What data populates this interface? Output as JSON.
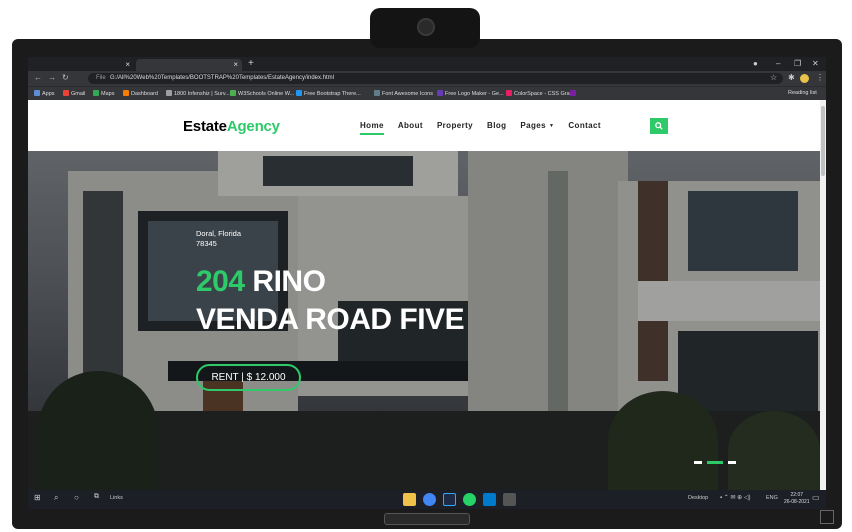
{
  "browser": {
    "tabs": [
      {
        "label": ""
      },
      {
        "label": ""
      }
    ],
    "new_tab": "+",
    "url_scheme": "File",
    "url": "G:/All%20Web%20Templates/BOOTSTRAP%20Templates/EstateAgency/index.html",
    "bookmarks": [
      {
        "label": "Apps",
        "color": "#5f8dd3"
      },
      {
        "label": "Gmail",
        "color": "#ea4335"
      },
      {
        "label": "Maps",
        "color": "#34a853"
      },
      {
        "label": "Dashboard",
        "color": "#f57c00"
      },
      {
        "label": "1800 Infenshiz | Surv...",
        "color": "#9e9e9e"
      },
      {
        "label": "W3Schools Online W...",
        "color": "#4caf50"
      },
      {
        "label": "Free Bootstrap There...",
        "color": "#2196f3"
      },
      {
        "label": "Font Awesome Icons",
        "color": "#607d8b"
      },
      {
        "label": "Free Logo Maker - Ge...",
        "color": "#673ab7"
      },
      {
        "label": "ColorSpace - CSS Gra...",
        "color": "#e91e63"
      }
    ],
    "reading_list": "Reading list"
  },
  "site": {
    "brand_part1": "Estate",
    "brand_part2": "Agency",
    "nav": [
      {
        "label": "Home",
        "active": true
      },
      {
        "label": "About"
      },
      {
        "label": "Property"
      },
      {
        "label": "Blog"
      },
      {
        "label": "Pages",
        "dropdown": true
      },
      {
        "label": "Contact"
      }
    ],
    "accent": "#2eca6a"
  },
  "hero": {
    "location_line1": "Doral, Florida",
    "location_line2": "78345",
    "title_number": "204",
    "title_rest1": " RINO",
    "title_line2": "VENDA ROAD FIVE",
    "price_button": "RENT | $ 12.000",
    "slides": 3,
    "active_slide": 1
  },
  "taskbar": {
    "links_label": "Links",
    "desktop_label": "Desktop",
    "lang": "ENG",
    "time": "22:07",
    "date": "26-08-2021"
  }
}
